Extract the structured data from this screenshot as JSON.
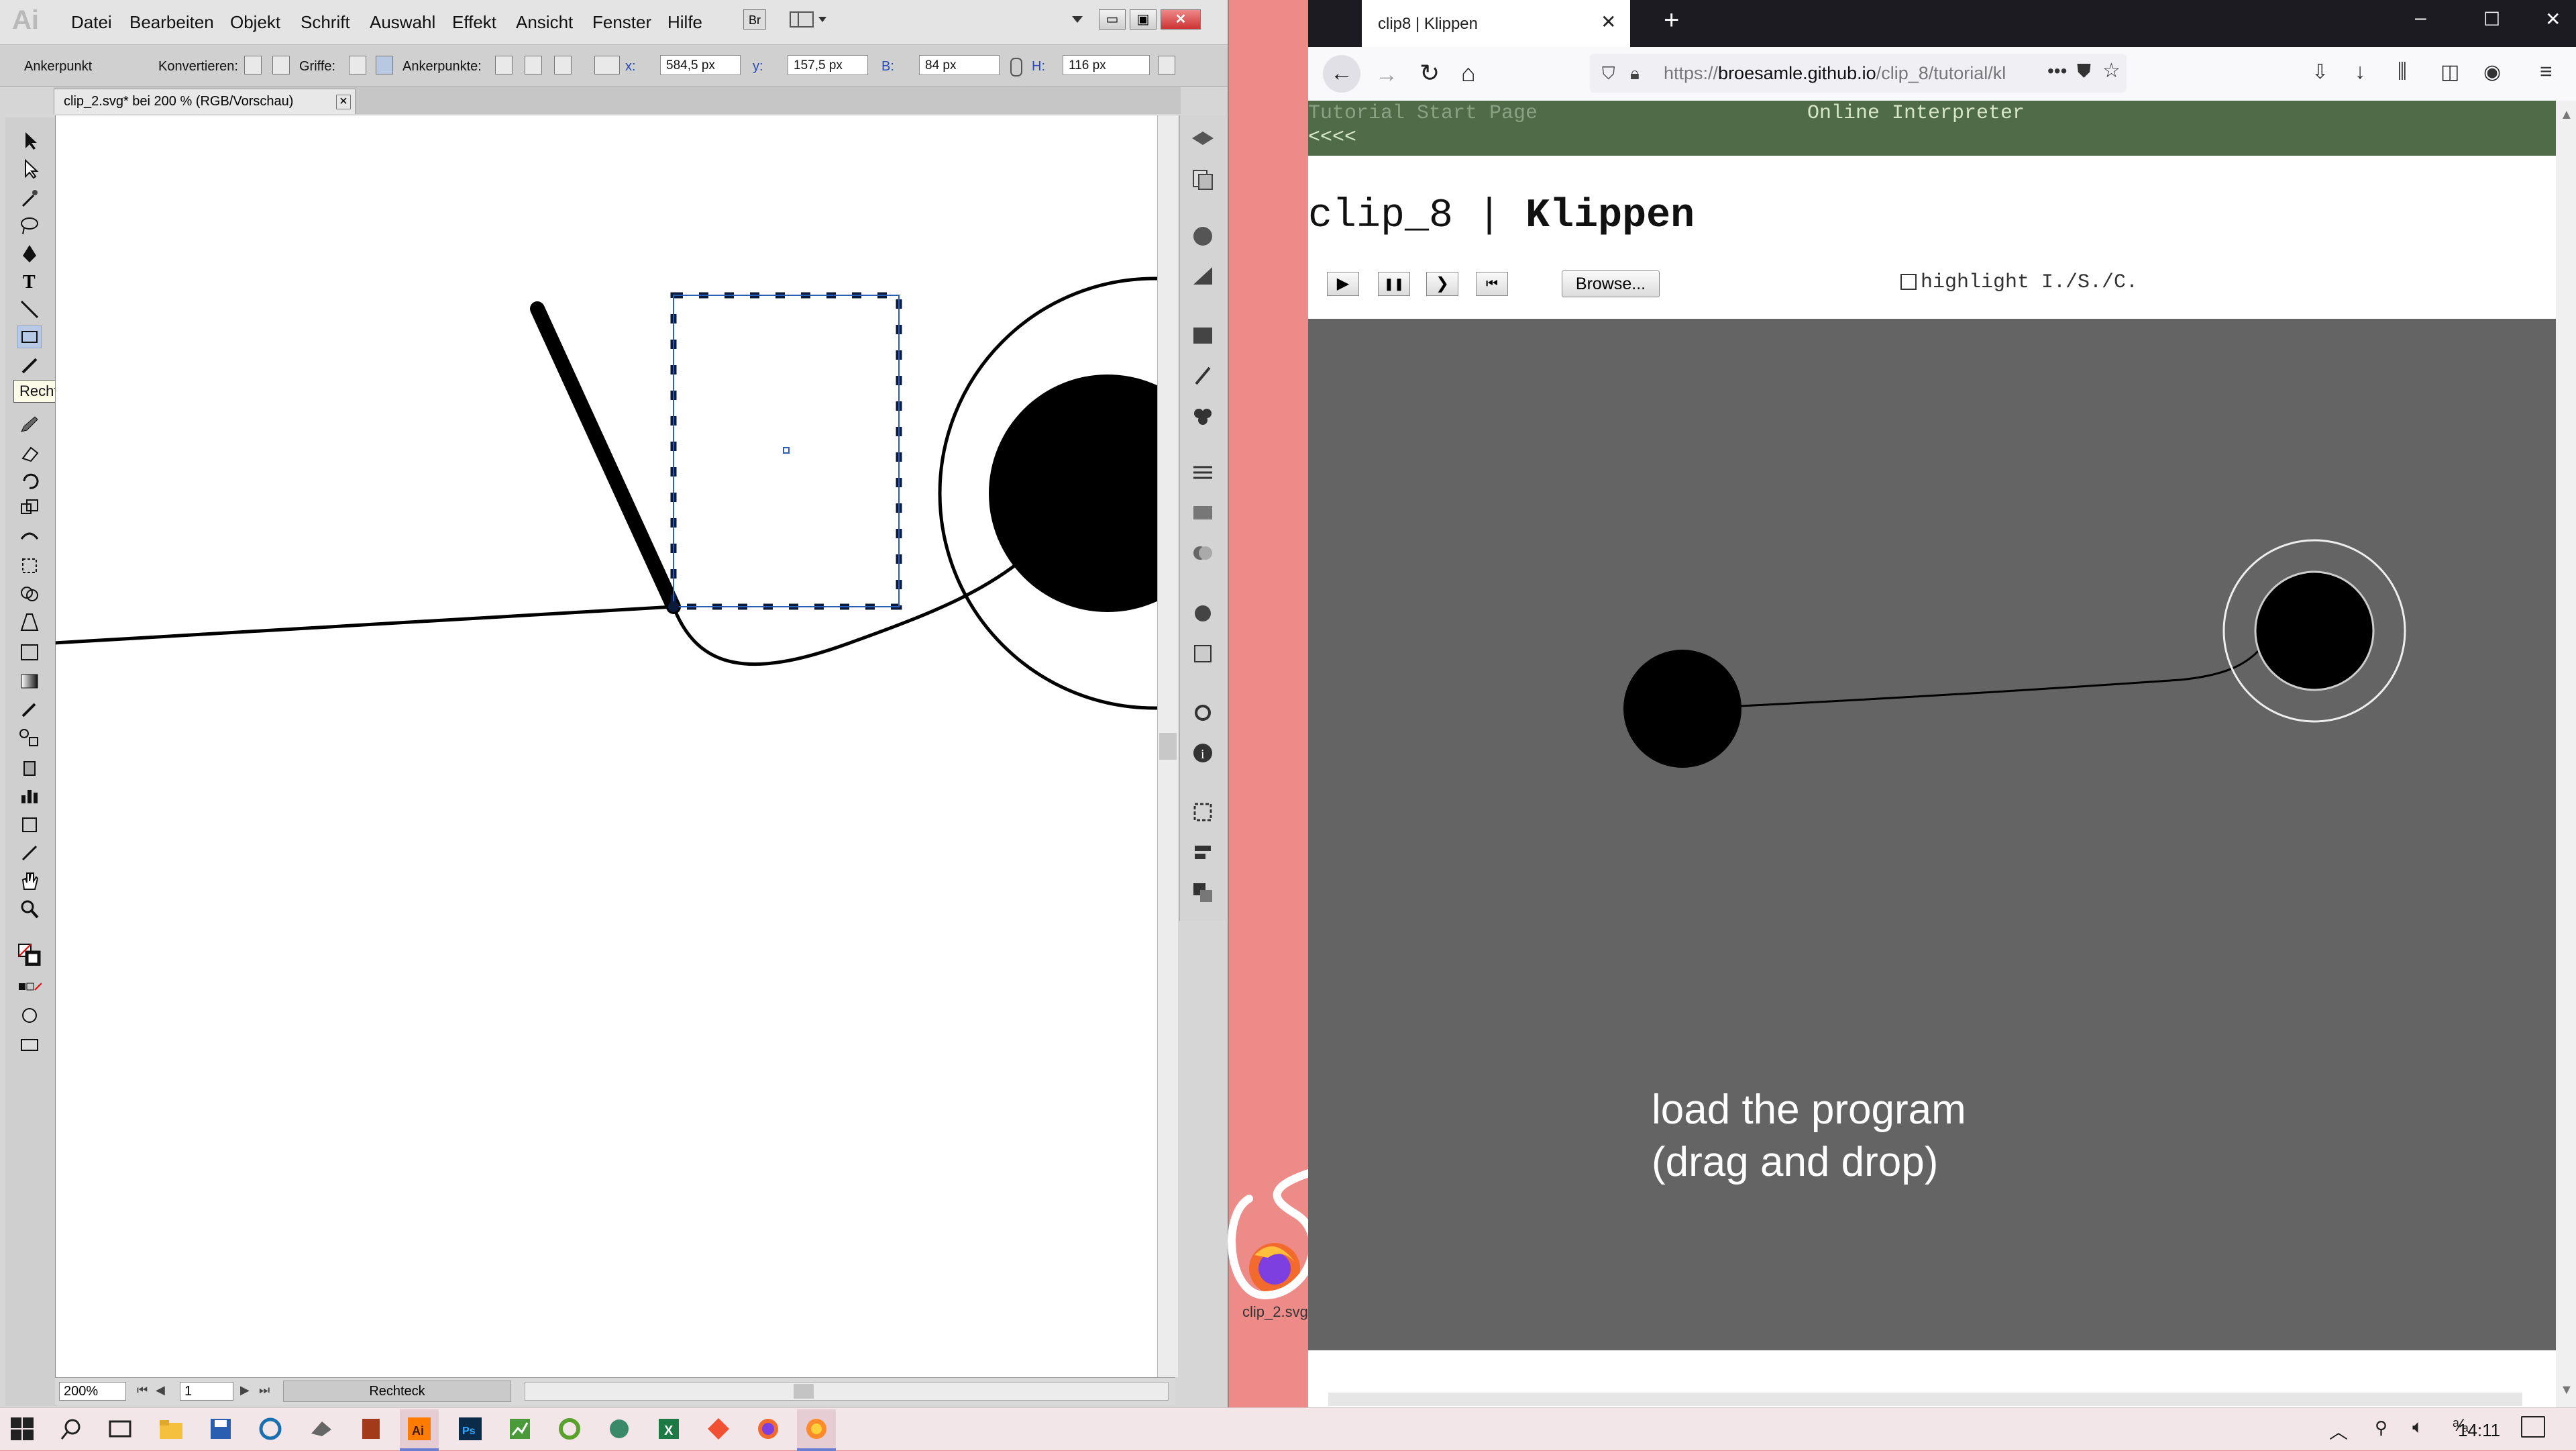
{
  "illustrator": {
    "logo": "Ai",
    "menu": [
      "Datei",
      "Bearbeiten",
      "Objekt",
      "Schrift",
      "Auswahl",
      "Effekt",
      "Ansicht",
      "Fenster",
      "Hilfe"
    ],
    "bridge_label": "Br",
    "control": {
      "mode_label": "Ankerpunkt",
      "convert_label": "Konvertieren:",
      "handles_label": "Griffe:",
      "anchors_label": "Ankerpunkte:",
      "x_label": "x:",
      "x_value": "584,5 px",
      "y_label": "y:",
      "y_value": "157,5 px",
      "w_label": "B:",
      "w_value": "84 px",
      "h_label": "H:",
      "h_value": "116 px"
    },
    "document_tab": "clip_2.svg* bei 200 % (RGB/Vorschau)",
    "tooltip": "Rechteck-Werkzeug (M)",
    "status": {
      "zoom": "200%",
      "artboard": "1",
      "tool": "Rechteck"
    }
  },
  "browser": {
    "tab_title": "clip8 | Klippen",
    "url_prefix": "https://",
    "url_host": "broesamle.github.io",
    "url_path": "/clip_8/tutorial/kl",
    "more_label": "•••"
  },
  "page": {
    "nav_start": "Tutorial Start Page",
    "nav_back": "<<<<",
    "nav_interpreter": "Online Interpreter",
    "title_light": "clip_8 | ",
    "title_bold": "Klippen",
    "play": "▶",
    "pause": "❚❚",
    "step": "❯",
    "rewind": "⏮",
    "browse": "Browse...",
    "highlight_label": "highlight I./S./C."
  },
  "annotation": {
    "line1": "load the program",
    "line2": "(drag and drop)"
  },
  "desktop": {
    "file_label": "clip_2.svg"
  },
  "taskbar": {
    "time": "14:11"
  },
  "colors": {
    "desktop": "#ed8b88",
    "banner": "#4f6b48",
    "run_area": "#646464",
    "firefox_dark": "#1c1b22"
  }
}
